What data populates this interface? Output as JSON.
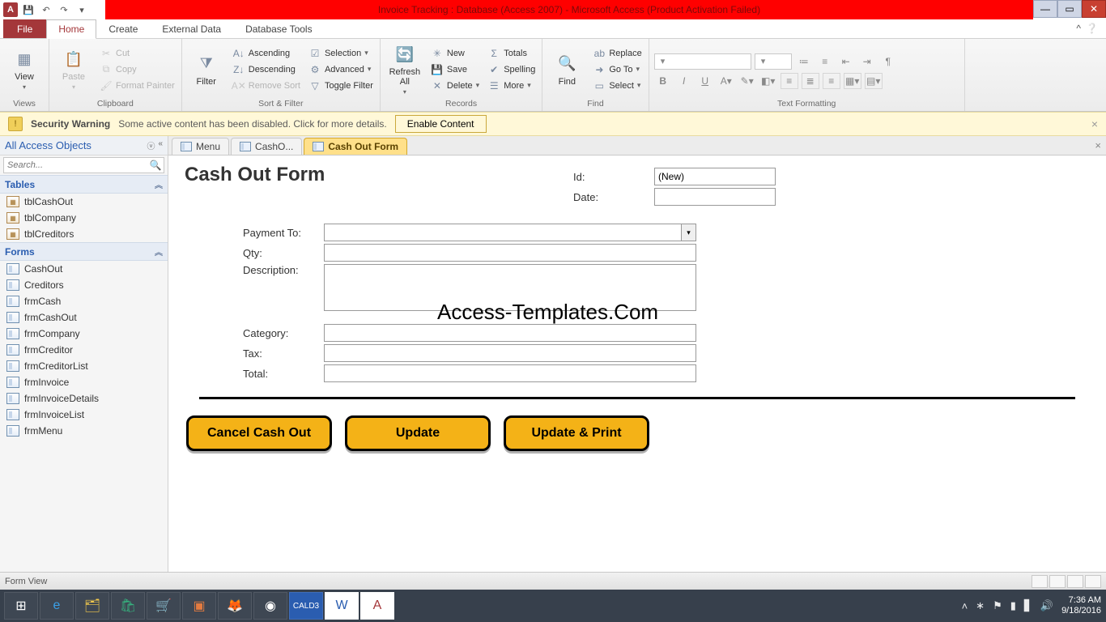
{
  "titlebar": {
    "app_logo_letter": "A",
    "title": "Invoice Tracking : Database (Access 2007) - Microsoft Access (Product Activation Failed)"
  },
  "ribbon_tabs": {
    "file": "File",
    "home": "Home",
    "create": "Create",
    "external": "External Data",
    "dbtools": "Database Tools"
  },
  "ribbon": {
    "views": {
      "view": "View",
      "group": "Views"
    },
    "clipboard": {
      "paste": "Paste",
      "cut": "Cut",
      "copy": "Copy",
      "fmt": "Format Painter",
      "group": "Clipboard"
    },
    "sortfilter": {
      "filter": "Filter",
      "asc": "Ascending",
      "desc": "Descending",
      "remove": "Remove Sort",
      "selection": "Selection",
      "advanced": "Advanced",
      "toggle": "Toggle Filter",
      "group": "Sort & Filter"
    },
    "records": {
      "refresh": "Refresh\nAll",
      "new": "New",
      "save": "Save",
      "delete": "Delete",
      "totals": "Totals",
      "spelling": "Spelling",
      "more": "More",
      "group": "Records"
    },
    "find": {
      "find": "Find",
      "replace": "Replace",
      "goto": "Go To",
      "select": "Select",
      "group": "Find"
    },
    "text": {
      "group": "Text Formatting"
    }
  },
  "security": {
    "title": "Security Warning",
    "msg": "Some active content has been disabled. Click for more details.",
    "btn": "Enable Content"
  },
  "nav": {
    "title": "All Access Objects",
    "search_placeholder": "Search...",
    "cat_tables": "Tables",
    "cat_forms": "Forms",
    "tables": [
      "tblCashOut",
      "tblCompany",
      "tblCreditors"
    ],
    "forms": [
      "CashOut",
      "Creditors",
      "frmCash",
      "frmCashOut",
      "frmCompany",
      "frmCreditor",
      "frmCreditorList",
      "frmInvoice",
      "frmInvoiceDetails",
      "frmInvoiceList",
      "frmMenu"
    ]
  },
  "doctabs": {
    "t1": "Menu",
    "t2": "CashO...",
    "t3": "Cash Out Form"
  },
  "form": {
    "title": "Cash Out Form",
    "id_label": "Id:",
    "id_value": "(New)",
    "date_label": "Date:",
    "payment_label": "Payment To:",
    "qty_label": "Qty:",
    "desc_label": "Description:",
    "cat_label": "Category:",
    "tax_label": "Tax:",
    "total_label": "Total:",
    "btn_cancel": "Cancel Cash Out",
    "btn_update": "Update",
    "btn_updateprint": "Update & Print"
  },
  "watermark": "Access-Templates.Com",
  "status": {
    "left": "Form View"
  },
  "tray": {
    "time": "7:36 AM",
    "date": "9/18/2016"
  }
}
